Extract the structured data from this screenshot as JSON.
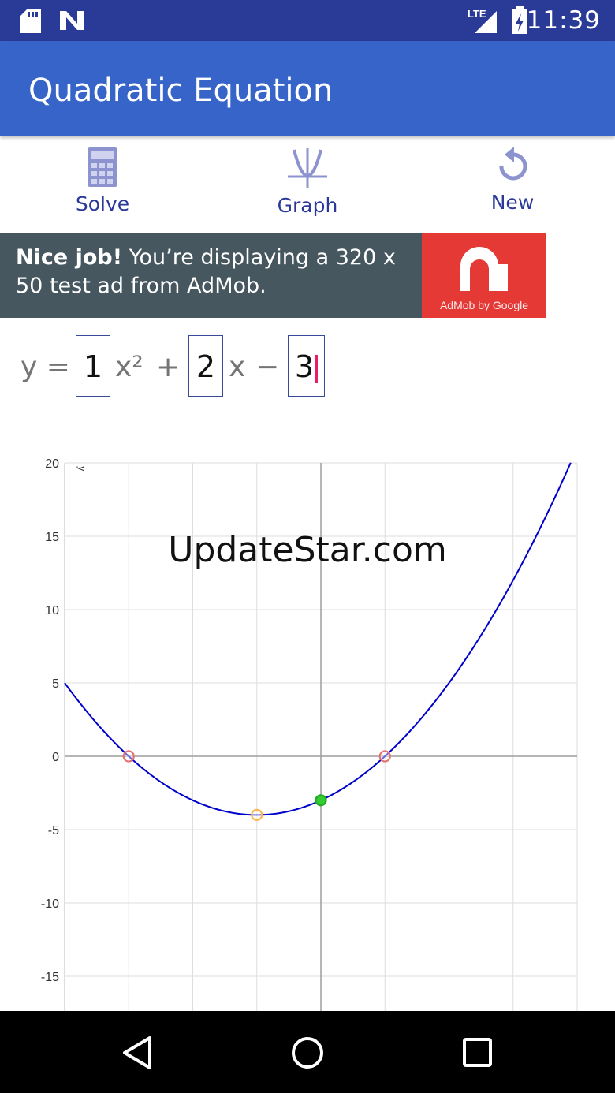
{
  "status_bar": {
    "time": "11:39",
    "network": "LTE",
    "icons": [
      "sd-card-icon",
      "n-logo-icon",
      "lte-signal-icon",
      "battery-icon"
    ]
  },
  "app_bar": {
    "title": "Quadratic Equation"
  },
  "toolbar": {
    "solve_label": "Solve",
    "graph_label": "Graph",
    "new_label": "New"
  },
  "ad": {
    "bold": "Nice job!",
    "text": " You’re displaying a 320 x 50 test ad from AdMob.",
    "logo_caption": "AdMob by Google"
  },
  "equation": {
    "prefix": "y =",
    "a": "1",
    "x2": "x²",
    "plus": "+",
    "b": "2",
    "x": "x",
    "minus": "−",
    "c": "3"
  },
  "watermark": "UpdateStar.com",
  "chart_data": {
    "type": "line",
    "title": "",
    "xlabel": "",
    "ylabel": "y",
    "ylim": [
      -17,
      20
    ],
    "xlim": [
      -4,
      4
    ],
    "y_ticks": [
      "20",
      "15",
      "10",
      "5",
      "0",
      "-5",
      "-10",
      "-15"
    ],
    "grid": true,
    "series": [
      {
        "expression": "x^2 + 2x - 3",
        "color": "#0000cc"
      }
    ],
    "points": [
      {
        "kind": "root",
        "x": -3,
        "y": 0,
        "color": "#e57373"
      },
      {
        "kind": "root",
        "x": 1,
        "y": 0,
        "color": "#e57373"
      },
      {
        "kind": "vertex",
        "x": -1,
        "y": -4,
        "color": "#ffb74d"
      },
      {
        "kind": "y-intercept",
        "x": 0,
        "y": -3,
        "color": "#22aa22"
      }
    ]
  },
  "colors": {
    "status_bar": "#2a3b97",
    "app_bar": "#3764c8",
    "accent": "#e91e63",
    "curve": "#0000cc"
  }
}
